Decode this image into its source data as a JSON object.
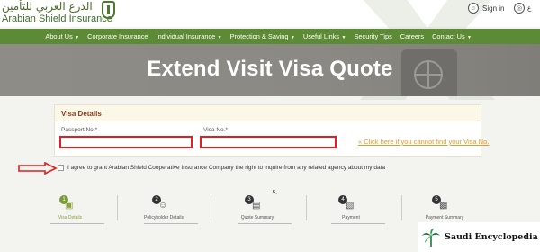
{
  "header": {
    "logo_arabic": "الدرع العربي للتأمين",
    "logo_english": "Arabian Shield Insurance",
    "signin_label": "Sign in",
    "language_label": "ع"
  },
  "nav": {
    "items": [
      {
        "label": "About Us",
        "has_dropdown": true
      },
      {
        "label": "Corporate Insurance",
        "has_dropdown": false
      },
      {
        "label": "Individual Insurance",
        "has_dropdown": true
      },
      {
        "label": "Protection & Saving",
        "has_dropdown": true
      },
      {
        "label": "Useful Links",
        "has_dropdown": true
      },
      {
        "label": "Security Tips",
        "has_dropdown": false
      },
      {
        "label": "Careers",
        "has_dropdown": false
      },
      {
        "label": "Contact Us",
        "has_dropdown": true
      }
    ]
  },
  "hero": {
    "title": "Extend Visit Visa Quote"
  },
  "form": {
    "section_title": "Visa Details",
    "passport_label": "Passport No.*",
    "passport_value": "",
    "visa_label": "Visa No.*",
    "visa_value": "",
    "help_link": "« Click here if you cannot find your Visa No."
  },
  "consent": {
    "text": "I agree to grant Arabian Shield Cooperative Insurance Company the right to inquire from any related agency about my data",
    "checked": false
  },
  "steps": [
    {
      "number": "1",
      "label": "Visa Details",
      "icon": "id-card-icon",
      "active": true
    },
    {
      "number": "2",
      "label": "Policyholder Details",
      "icon": "user-icon",
      "active": false
    },
    {
      "number": "3",
      "label": "Quote Summary",
      "icon": "document-icon",
      "active": false
    },
    {
      "number": "4",
      "label": "Payment",
      "icon": "card-icon",
      "active": false
    },
    {
      "number": "5",
      "label": "Payment Summary",
      "icon": "receipt-icon",
      "active": false
    }
  ],
  "watermark": {
    "text": "Saudi Encyclopedia"
  },
  "colors": {
    "nav_green": "#5d8a35",
    "title_brown": "#8a3b1f",
    "link_orange": "#e49a2a",
    "highlight_red": "#e02020",
    "active_step": "#8aa33d"
  }
}
